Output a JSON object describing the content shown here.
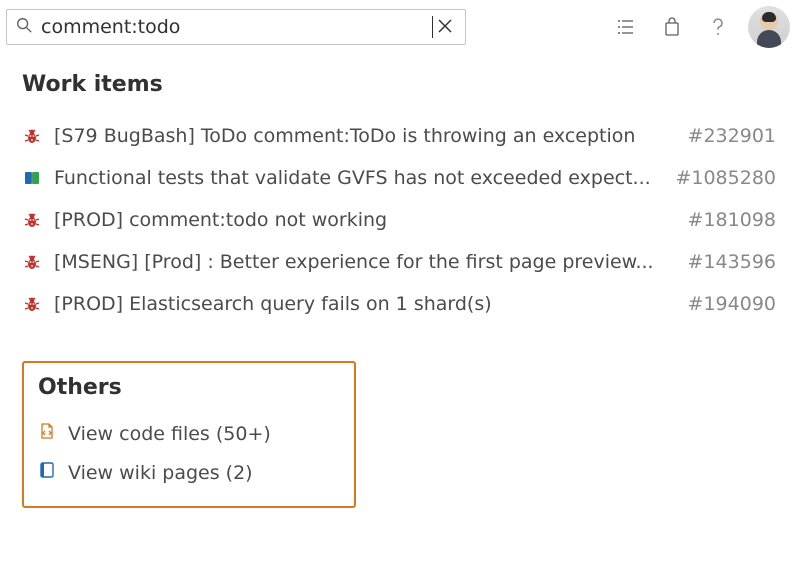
{
  "search": {
    "value": "comment:todo",
    "placeholder": ""
  },
  "sections": {
    "workItems": {
      "title": "Work items",
      "items": [
        {
          "icon": "bug",
          "title": "[S79 BugBash] ToDo comment:ToDo is throwing an exception",
          "id": "#232901"
        },
        {
          "icon": "book",
          "title": "Functional tests that validate GVFS has not exceeded expect...",
          "id": "#1085280"
        },
        {
          "icon": "bug",
          "title": "[PROD] comment:todo not working",
          "id": "#181098"
        },
        {
          "icon": "bug",
          "title": "[MSENG] [Prod] : Better experience for the first page preview...",
          "id": "#143596"
        },
        {
          "icon": "bug",
          "title": "[PROD] Elasticsearch query fails on 1 shard(s)",
          "id": "#194090"
        }
      ]
    },
    "others": {
      "title": "Others",
      "links": [
        {
          "icon": "code",
          "label": "View code files (50+)"
        },
        {
          "icon": "wiki",
          "label": "View wiki pages (2)"
        }
      ]
    }
  }
}
